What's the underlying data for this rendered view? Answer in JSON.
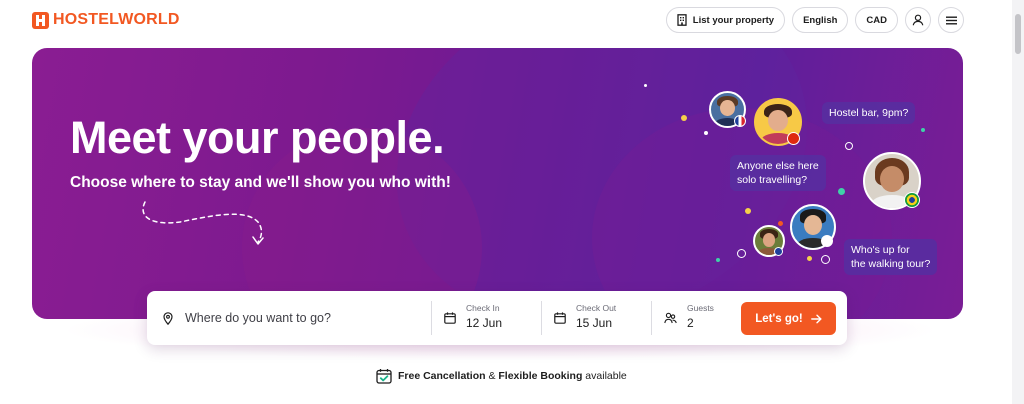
{
  "header": {
    "logo_text": "HOSTELWORLD",
    "list_property_label": "List your property",
    "language_label": "English",
    "currency_label": "CAD",
    "icons": {
      "building": "building-icon",
      "account": "user-icon",
      "menu": "hamburger-menu-icon"
    }
  },
  "hero": {
    "title": "Meet your people.",
    "subtitle": "Choose where to stay and we'll show you who with!",
    "bubbles": {
      "hostel_bar": "Hostel bar, 9pm?",
      "solo_line1": "Anyone else here",
      "solo_line2": "solo travelling?",
      "walking_line1": "Who's up for",
      "walking_line2": "the walking tour?"
    },
    "colors": {
      "gradient_start": "#8a1d92",
      "gradient_end": "#5f1e9b",
      "bubble": "#582da0"
    }
  },
  "search": {
    "destination_placeholder": "Where do you want to go?",
    "check_in": {
      "label": "Check In",
      "value": "12 Jun"
    },
    "check_out": {
      "label": "Check Out",
      "value": "15 Jun"
    },
    "guests": {
      "label": "Guests",
      "value": "2"
    },
    "submit_label": "Let's go!",
    "icons": {
      "location": "location-pin-icon",
      "calendar": "calendar-icon",
      "guests": "guests-icon",
      "arrow": "arrow-right-icon"
    }
  },
  "perk": {
    "part1": "Free Cancellation",
    "part2": " & ",
    "part3": "Flexible Booking",
    "part4": " available",
    "icon": "calendar-check-icon"
  },
  "brand_color": "#f25822"
}
